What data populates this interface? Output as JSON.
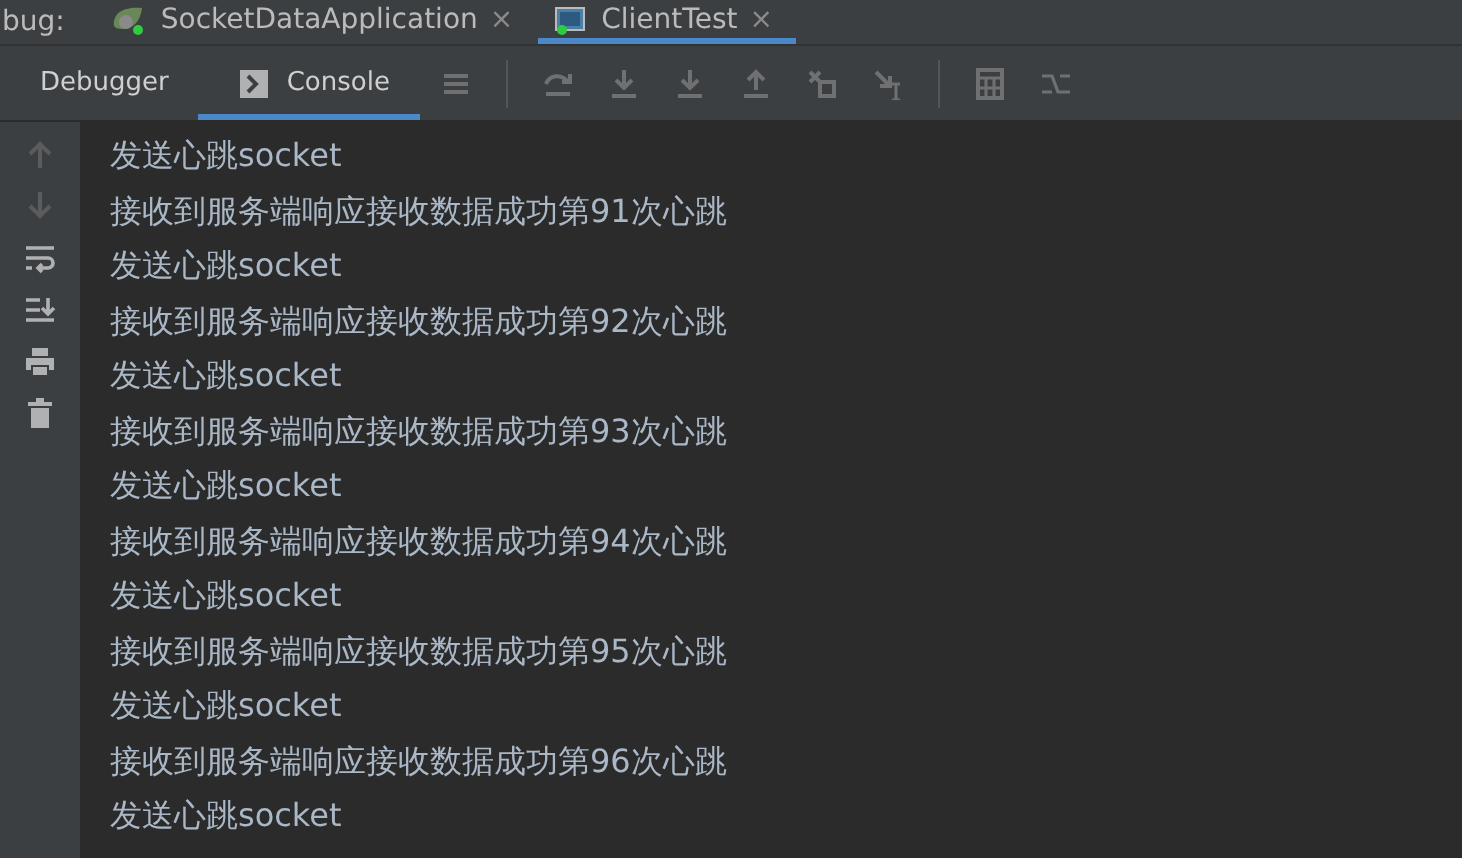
{
  "run_tabs_label": "bug:",
  "run_tabs": [
    {
      "title": "SocketDataApplication",
      "close": "×",
      "kind": "spring",
      "selected": false
    },
    {
      "title": "ClientTest",
      "close": "×",
      "kind": "app",
      "selected": true
    }
  ],
  "tool_tabs": [
    {
      "label": "Debugger",
      "kind": "plain",
      "selected": false
    },
    {
      "label": "Console",
      "kind": "console",
      "selected": true
    }
  ],
  "console_lines": [
    "发送心跳socket",
    "接收到服务端响应接收数据成功第91次心跳",
    "发送心跳socket",
    "接收到服务端响应接收数据成功第92次心跳",
    "发送心跳socket",
    "接收到服务端响应接收数据成功第93次心跳",
    "发送心跳socket",
    "接收到服务端响应接收数据成功第94次心跳",
    "发送心跳socket",
    "接收到服务端响应接收数据成功第95次心跳",
    "发送心跳socket",
    "接收到服务端响应接收数据成功第96次心跳",
    "发送心跳socket"
  ]
}
